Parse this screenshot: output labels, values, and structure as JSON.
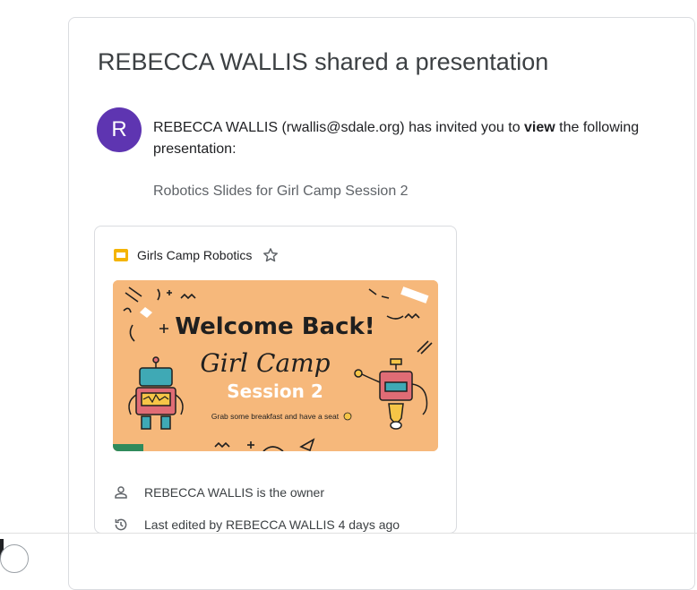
{
  "email": {
    "headline": "REBECCA WALLIS shared a presentation",
    "avatar_letter": "R",
    "avatar_color": "#5e35b1",
    "sender_intro": "REBECCA WALLIS (rwallis@sdale.org) has invited you to ",
    "permission": "view",
    "invite_suffix": " the following presentation:",
    "document_name": "Robotics Slides for Girl Camp Session 2"
  },
  "preview": {
    "file_title": "Girls Camp Robotics",
    "file_icon": "google-slides-icon",
    "star_icon": "star-outline-icon",
    "slide": {
      "heading": "Welcome Back!",
      "script_title": "Girl Camp",
      "session": "Session 2",
      "subtitle": "Grab some breakfast and have a seat",
      "background_color": "#f6b87b"
    },
    "owner_text": "REBECCA WALLIS is the owner",
    "owner_icon": "person-icon",
    "edited_text": "Last edited by REBECCA WALLIS 4 days ago",
    "edited_icon": "history-icon"
  }
}
